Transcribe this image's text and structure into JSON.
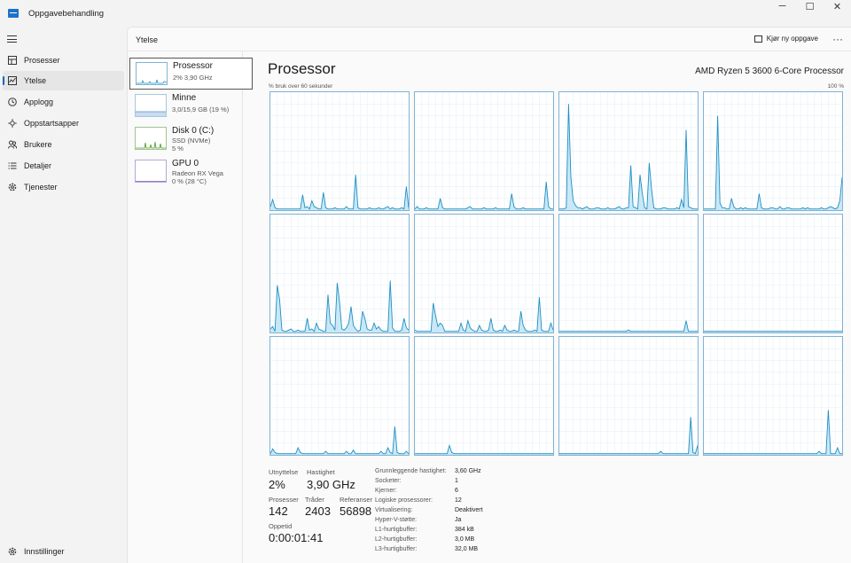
{
  "window": {
    "title": "Oppgavebehandling",
    "minimize": "─",
    "maximize": "☐",
    "close": "✕"
  },
  "sidebar": {
    "items": [
      {
        "label": "Prosesser",
        "icon": "grid-icon"
      },
      {
        "label": "Ytelse",
        "icon": "performance-icon"
      },
      {
        "label": "Applogg",
        "icon": "history-icon"
      },
      {
        "label": "Oppstartsapper",
        "icon": "startup-icon"
      },
      {
        "label": "Brukere",
        "icon": "users-icon"
      },
      {
        "label": "Detaljer",
        "icon": "list-icon"
      },
      {
        "label": "Tjenester",
        "icon": "gear-icon"
      }
    ],
    "settings_label": "Innstillinger"
  },
  "header": {
    "section_title": "Ytelse",
    "run_task_label": "Kjør ny oppgave",
    "more_label": "···"
  },
  "resources": [
    {
      "name": "Prosessor",
      "sub1": "2% 3,90 GHz",
      "sub2": ""
    },
    {
      "name": "Minne",
      "sub1": "3,0/15,9 GB (19 %)",
      "sub2": ""
    },
    {
      "name": "Disk 0 (C:)",
      "sub1": "SSD (NVMe)",
      "sub2": "5 %"
    },
    {
      "name": "GPU 0",
      "sub1": "Radeon RX Vega",
      "sub2": "0 % (28 °C)"
    }
  ],
  "cpu": {
    "title": "Prosessor",
    "model": "AMD Ryzen 5 3600 6-Core Processor",
    "graph_caption": "% bruk over 60 sekunder",
    "graph_max": "100 %",
    "line_color": "#1e8fc6",
    "fill_color": "#c9e8f5",
    "cores": [
      [
        0,
        0,
        8,
        3,
        1,
        0,
        0,
        1,
        0,
        0,
        0,
        1,
        2,
        1,
        0,
        0,
        0,
        0,
        0,
        0,
        1,
        0,
        0,
        0,
        14,
        2,
        6,
        3,
        1,
        12,
        4,
        2,
        1,
        0,
        1,
        0,
        2,
        0,
        1,
        0,
        2,
        3,
        0,
        0,
        1,
        0,
        4,
        9,
        2,
        0,
        0,
        1,
        3,
        28,
        3,
        0,
        1,
        0,
        0,
        0,
        2,
        1,
        1,
        0,
        22,
        3
      ],
      [
        0,
        0,
        1,
        0,
        1,
        4,
        2,
        1,
        0,
        1,
        0,
        0,
        5,
        2,
        0,
        1,
        0,
        0,
        0,
        1,
        0,
        0,
        0,
        1,
        0,
        0,
        0,
        0,
        0,
        1,
        0,
        1,
        0,
        0,
        0,
        0,
        0,
        0,
        0,
        0,
        1,
        0,
        11,
        2,
        0,
        1,
        0,
        0,
        0,
        1,
        0,
        0,
        1,
        0,
        0,
        0,
        0,
        0,
        0,
        1,
        20,
        2,
        1,
        0,
        0,
        0
      ],
      [
        0,
        1,
        0,
        0,
        2,
        1,
        0,
        0,
        0,
        1,
        1,
        4,
        1,
        0,
        2,
        1,
        1,
        0,
        0,
        0,
        1,
        1,
        3,
        1,
        1,
        0,
        1,
        0,
        2,
        1,
        1,
        0,
        1,
        2,
        1,
        0,
        1,
        0,
        1,
        0,
        1,
        1,
        0,
        3,
        1,
        0,
        1,
        0,
        2,
        1,
        1,
        0,
        1,
        0,
        2,
        1,
        1,
        0,
        1,
        0,
        2,
        0,
        1,
        0,
        1,
        1
      ],
      [
        0,
        1,
        0,
        0,
        1,
        0,
        1,
        7,
        5,
        3,
        0,
        1,
        0,
        4,
        1,
        0,
        2,
        0,
        1,
        0,
        1,
        0,
        0,
        1,
        0,
        2,
        1,
        0,
        1,
        0,
        1,
        0,
        2,
        0,
        1,
        3,
        4,
        1,
        2,
        0,
        1,
        0,
        2,
        1,
        0,
        1,
        0,
        0,
        1,
        0,
        0,
        0,
        1,
        2,
        0,
        0,
        0,
        1,
        2,
        0,
        1,
        0,
        0,
        0,
        0,
        0,
        0,
        1,
        0,
        5,
        3,
        0
      ]
    ]
  },
  "stats": {
    "utilization_label": "Utnyttelse",
    "utilization_value": "2%",
    "speed_label": "Hastighet",
    "speed_value": "3,90 GHz",
    "processes_label": "Prosesser",
    "processes_value": "142",
    "threads_label": "Tråder",
    "threads_value": "2403",
    "handles_label": "Referanser",
    "handles_value": "56898",
    "uptime_label": "Oppetid",
    "uptime_value": "0:00:01:41",
    "details": [
      {
        "k": "Grunnleggende hastighet:",
        "v": "3,60 GHz"
      },
      {
        "k": "Socketer:",
        "v": "1"
      },
      {
        "k": "Kjerner:",
        "v": "6"
      },
      {
        "k": "Logiske prosessorer:",
        "v": "12"
      },
      {
        "k": "Virtualisering:",
        "v": "Deaktivert"
      },
      {
        "k": "Hyper-V-støtte:",
        "v": "Ja"
      },
      {
        "k": "L1-hurtigbuffer:",
        "v": "384 kB"
      },
      {
        "k": "L2-hurtigbuffer:",
        "v": "3,0 MB"
      },
      {
        "k": "L3-hurtigbuffer:",
        "v": "32,0 MB"
      }
    ]
  },
  "core_series": [
    [
      3,
      9,
      2,
      1,
      1,
      1,
      1,
      1,
      1,
      1,
      1,
      1,
      1,
      1,
      13,
      2,
      3,
      1,
      8,
      3,
      2,
      1,
      1,
      15,
      2,
      1,
      1,
      1,
      2,
      1,
      1,
      1,
      1,
      3,
      1,
      1,
      1,
      30,
      2,
      1,
      1,
      1,
      1,
      2,
      1,
      1,
      1,
      2,
      1,
      1,
      2,
      3,
      1,
      2,
      1,
      1,
      1,
      2,
      1,
      20,
      2
    ],
    [
      1,
      3,
      1,
      1,
      1,
      2,
      1,
      1,
      1,
      1,
      1,
      10,
      2,
      1,
      1,
      1,
      1,
      1,
      1,
      1,
      1,
      1,
      1,
      2,
      3,
      1,
      1,
      1,
      1,
      1,
      2,
      1,
      1,
      1,
      1,
      2,
      1,
      1,
      1,
      1,
      1,
      1,
      14,
      3,
      1,
      1,
      1,
      2,
      1,
      1,
      1,
      1,
      1,
      1,
      1,
      1,
      1,
      24,
      3,
      1,
      1
    ],
    [
      1,
      1,
      1,
      2,
      90,
      28,
      8,
      4,
      2,
      2,
      1,
      2,
      3,
      1,
      1,
      1,
      2,
      2,
      1,
      1,
      1,
      2,
      1,
      1,
      1,
      2,
      3,
      1,
      1,
      2,
      2,
      38,
      3,
      2,
      1,
      30,
      14,
      2,
      1,
      40,
      18,
      2,
      1,
      1,
      1,
      2,
      2,
      1,
      1,
      1,
      1,
      2,
      1,
      9,
      2,
      68,
      3,
      2,
      1,
      1,
      1
    ],
    [
      1,
      1,
      1,
      1,
      1,
      1,
      80,
      6,
      2,
      2,
      1,
      1,
      10,
      3,
      1,
      1,
      2,
      1,
      2,
      1,
      1,
      1,
      1,
      1,
      14,
      2,
      1,
      1,
      1,
      2,
      2,
      1,
      1,
      3,
      1,
      1,
      2,
      2,
      1,
      1,
      1,
      1,
      1,
      2,
      1,
      2,
      1,
      1,
      1,
      1,
      1,
      2,
      1,
      1,
      2,
      3,
      2,
      1,
      2,
      8,
      28
    ],
    [
      3,
      5,
      1,
      40,
      28,
      2,
      1,
      1,
      2,
      3,
      1,
      1,
      2,
      1,
      1,
      1,
      12,
      2,
      3,
      1,
      8,
      3,
      2,
      1,
      1,
      32,
      8,
      6,
      2,
      42,
      26,
      3,
      2,
      4,
      8,
      22,
      6,
      3,
      1,
      2,
      18,
      12,
      3,
      2,
      2,
      8,
      3,
      5,
      2,
      1,
      1,
      1,
      44,
      4,
      1,
      1,
      1,
      2,
      12,
      4,
      2
    ],
    [
      2,
      1,
      1,
      1,
      1,
      1,
      1,
      1,
      25,
      14,
      5,
      8,
      6,
      1,
      1,
      1,
      1,
      1,
      1,
      1,
      8,
      2,
      1,
      10,
      4,
      2,
      1,
      1,
      6,
      2,
      1,
      1,
      2,
      12,
      2,
      1,
      1,
      2,
      1,
      6,
      2,
      1,
      1,
      2,
      1,
      1,
      18,
      6,
      2,
      1,
      1,
      1,
      2,
      1,
      30,
      2,
      1,
      1,
      1,
      8,
      2
    ],
    [
      1,
      1,
      1,
      1,
      1,
      1,
      1,
      1,
      1,
      1,
      1,
      1,
      1,
      1,
      1,
      1,
      1,
      1,
      1,
      1,
      1,
      1,
      1,
      1,
      1,
      1,
      1,
      1,
      1,
      1,
      2,
      1,
      1,
      1,
      1,
      1,
      1,
      1,
      1,
      1,
      1,
      1,
      1,
      1,
      1,
      1,
      1,
      1,
      1,
      1,
      1,
      1,
      1,
      1,
      1,
      10,
      1,
      1,
      1,
      1,
      1
    ],
    [
      1,
      1,
      1,
      1,
      1,
      1,
      1,
      1,
      1,
      1,
      1,
      1,
      1,
      1,
      1,
      1,
      1,
      1,
      1,
      1,
      1,
      1,
      1,
      1,
      1,
      1,
      1,
      1,
      1,
      1,
      1,
      1,
      1,
      1,
      1,
      1,
      1,
      1,
      1,
      1,
      1,
      1,
      1,
      1,
      1,
      1,
      1,
      1,
      1,
      1,
      1,
      1,
      1,
      1,
      1,
      1,
      1,
      1,
      1,
      1,
      1
    ],
    [
      1,
      5,
      2,
      1,
      1,
      1,
      1,
      1,
      1,
      1,
      1,
      1,
      6,
      2,
      1,
      1,
      1,
      1,
      1,
      1,
      1,
      1,
      1,
      1,
      3,
      1,
      1,
      1,
      1,
      1,
      1,
      1,
      1,
      3,
      1,
      1,
      4,
      1,
      1,
      1,
      1,
      1,
      1,
      1,
      1,
      1,
      1,
      1,
      3,
      1,
      1,
      6,
      2,
      1,
      24,
      2,
      1,
      1,
      1,
      3,
      1
    ],
    [
      1,
      1,
      1,
      1,
      1,
      1,
      1,
      1,
      1,
      1,
      1,
      1,
      1,
      1,
      1,
      8,
      2,
      1,
      1,
      1,
      1,
      1,
      1,
      1,
      1,
      1,
      1,
      1,
      1,
      1,
      1,
      1,
      1,
      1,
      1,
      1,
      1,
      1,
      1,
      1,
      1,
      1,
      1,
      1,
      1,
      1,
      1,
      1,
      1,
      1,
      1,
      1,
      1,
      1,
      1,
      1,
      1,
      1,
      1,
      1,
      1
    ],
    [
      1,
      1,
      1,
      1,
      1,
      1,
      1,
      1,
      1,
      1,
      1,
      1,
      1,
      1,
      1,
      1,
      1,
      1,
      1,
      1,
      1,
      1,
      1,
      1,
      1,
      1,
      1,
      1,
      1,
      1,
      1,
      1,
      1,
      1,
      1,
      1,
      1,
      1,
      1,
      1,
      1,
      1,
      1,
      1,
      3,
      1,
      1,
      1,
      1,
      1,
      1,
      1,
      1,
      1,
      1,
      1,
      1,
      32,
      2,
      1,
      8
    ],
    [
      1,
      1,
      1,
      1,
      1,
      1,
      1,
      1,
      1,
      1,
      1,
      1,
      1,
      1,
      1,
      1,
      1,
      1,
      1,
      1,
      1,
      1,
      1,
      1,
      1,
      1,
      1,
      1,
      1,
      1,
      1,
      1,
      1,
      1,
      1,
      1,
      1,
      1,
      1,
      1,
      1,
      1,
      1,
      1,
      1,
      1,
      1,
      1,
      1,
      1,
      3,
      1,
      1,
      1,
      38,
      1,
      1,
      1,
      6,
      1,
      1
    ]
  ]
}
